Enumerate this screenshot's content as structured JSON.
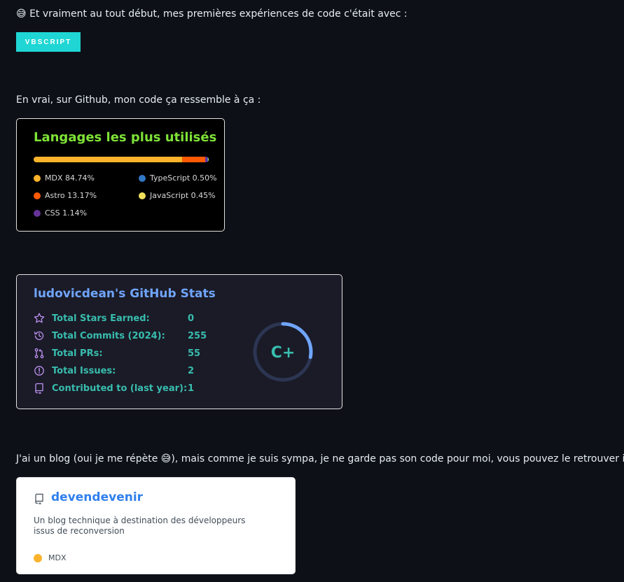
{
  "intro": {
    "emoji": "😅",
    "text": "Et vraiment au tout début, mes premières expériences de code c'était avec :"
  },
  "badge": {
    "label": "VBSCRIPT",
    "color": "#1fd6d4"
  },
  "github_intro": {
    "text": "En vrai, sur Github, mon code ça ressemble à ça :"
  },
  "languages": {
    "title": "Langages les plus utilisés",
    "items": [
      {
        "name": "MDX",
        "percent": 84.74,
        "label": "MDX 84.74%",
        "color": "#fcb32c"
      },
      {
        "name": "Astro",
        "percent": 13.17,
        "label": "Astro 13.17%",
        "color": "#ff5a03"
      },
      {
        "name": "CSS",
        "percent": 1.14,
        "label": "CSS 1.14%",
        "color": "#663399"
      },
      {
        "name": "TypeScript",
        "percent": 0.5,
        "label": "TypeScript 0.50%",
        "color": "#3178c6"
      },
      {
        "name": "JavaScript",
        "percent": 0.45,
        "label": "JavaScript 0.45%",
        "color": "#f1e05a"
      }
    ]
  },
  "stats": {
    "title": "ludovicdean's GitHub Stats",
    "rows": [
      {
        "icon": "star-icon",
        "label": "Total Stars Earned:",
        "value": "0"
      },
      {
        "icon": "history-icon",
        "label": "Total Commits (2024):",
        "value": "255"
      },
      {
        "icon": "pull-request-icon",
        "label": "Total PRs:",
        "value": "55"
      },
      {
        "icon": "issue-icon",
        "label": "Total Issues:",
        "value": "2"
      },
      {
        "icon": "repo-icon",
        "label": "Contributed to (last year):",
        "value": "1"
      }
    ],
    "rank": {
      "grade": "C+",
      "progress": 0.28
    },
    "colors": {
      "title": "#70a5fd",
      "text": "#38bdae",
      "icon": "#bf91f3",
      "ring": "#70a5fd"
    }
  },
  "blog_intro": {
    "text_before": "J'ai un blog (oui je me répète ",
    "emoji": "😅",
    "text_after": "), mais comme je suis sympa, je ne garde pas son code pour moi, vous pouvez le retrouver ici !"
  },
  "repo": {
    "name": "devendevenir",
    "description": "Un blog technique à destination des développeurs issus de reconversion",
    "language": "MDX",
    "language_color": "#fcb32c"
  }
}
